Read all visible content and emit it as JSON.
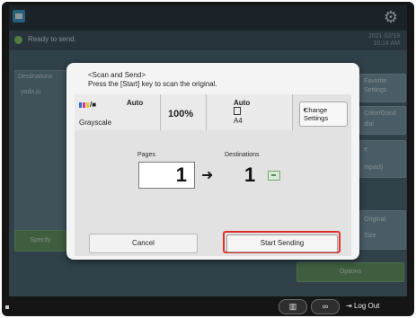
{
  "header": {
    "status_text": "Ready to send.",
    "status_date_1": "2021 02/19",
    "status_date_2": "10:14 AM"
  },
  "background": {
    "destinations_label": "Destinations",
    "destination_item": "yoda.ju",
    "specify_label": "Specify",
    "favorite_settings_label_1": "Favorite",
    "favorite_settings_label_2": "Settings",
    "color_good_label": "Color/Good",
    "dial_label": "dial",
    "e_label": "e",
    "compact_label": "mpact)",
    "original_label": "Original",
    "size_label": "Size",
    "options_label": "Options"
  },
  "dialog": {
    "title": "<Scan and Send>",
    "instruction": "Press the [Start] key to scan the original.",
    "color_mode": "Grayscale",
    "auto_1": "Auto",
    "zoom": "100%",
    "auto_2": "Auto",
    "paper_size": "A4",
    "change_settings_1": "Change",
    "change_settings_2": "Settings",
    "pages_label": "Pages",
    "pages_count": "1",
    "destinations_label": "Destinations",
    "destinations_count": "1",
    "cancel_label": "Cancel",
    "start_sending_label": "Start Sending"
  },
  "bottom": {
    "logout_label": "Log Out"
  },
  "colors": {
    "accent_outline": "#e0302a",
    "status_dot": "#8fd16a"
  },
  "icons": [
    "app-icon",
    "gear-icon",
    "status-dot-icon",
    "color-mode-icon",
    "arrow-right-icon",
    "destination-icon",
    "counter-icon",
    "link-icon",
    "logout-icon"
  ]
}
